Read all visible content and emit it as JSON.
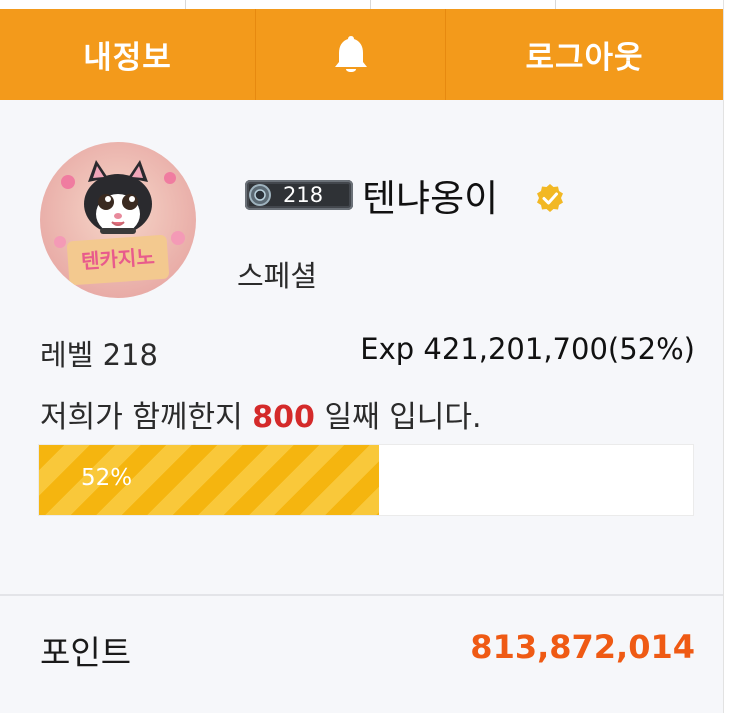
{
  "header": {
    "my_info_label": "내정보",
    "bell_icon": "bell-icon",
    "logout_label": "로그아웃"
  },
  "profile": {
    "level_badge": "218",
    "nickname": "텐냐옹이",
    "verified_icon": "verified-check-icon",
    "rank": "스페셜",
    "avatar_text": "텐카지노",
    "level_text": "레벨 218",
    "exp_text": "Exp 421,201,700(52%)",
    "days_prefix": "저희가 함께한지",
    "days_value": "800",
    "days_suffix": "일째 입니다.",
    "progress_percent": 52,
    "progress_label": "52%"
  },
  "points": {
    "label": "포인트",
    "value": "813,872,014"
  },
  "colors": {
    "header": "#f39a1b",
    "progress": "#f5b50f",
    "points_value": "#ef5a14",
    "days_highlight": "#d42a2a"
  }
}
